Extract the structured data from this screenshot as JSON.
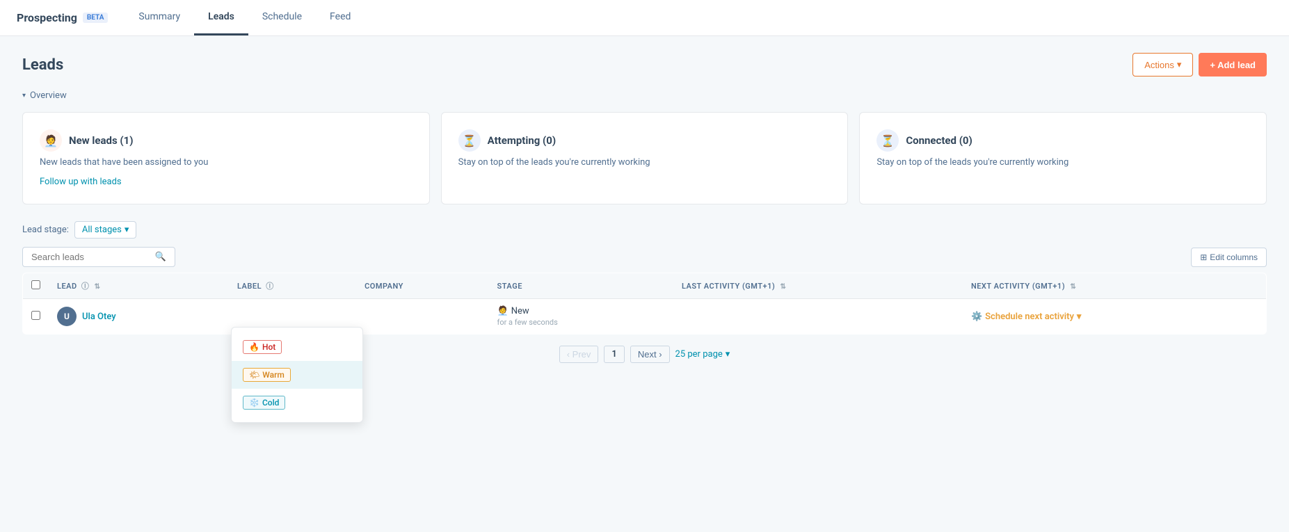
{
  "app": {
    "title": "Prospecting",
    "beta_label": "BETA"
  },
  "nav": {
    "tabs": [
      {
        "id": "summary",
        "label": "Summary",
        "active": false
      },
      {
        "id": "leads",
        "label": "Leads",
        "active": true
      },
      {
        "id": "schedule",
        "label": "Schedule",
        "active": false
      },
      {
        "id": "feed",
        "label": "Feed",
        "active": false
      }
    ]
  },
  "page": {
    "title": "Leads",
    "actions_label": "Actions",
    "add_lead_label": "+ Add lead"
  },
  "overview": {
    "section_label": "Overview",
    "cards": [
      {
        "id": "new-leads",
        "icon": "🧑‍💼",
        "title": "New leads (1)",
        "description": "New leads that have been assigned to you",
        "link_text": "Follow up with leads",
        "icon_bg": "new"
      },
      {
        "id": "attempting",
        "icon": "⏳",
        "title": "Attempting (0)",
        "description": "Stay on top of the leads you're currently working",
        "link_text": "",
        "icon_bg": "attempting"
      },
      {
        "id": "connected",
        "icon": "⏳",
        "title": "Connected (0)",
        "description": "Stay on top of the leads you're currently working",
        "link_text": "",
        "icon_bg": "connected"
      }
    ]
  },
  "stage_filter": {
    "label": "Lead stage:",
    "selected": "All stages"
  },
  "search": {
    "placeholder": "Search leads"
  },
  "edit_columns_label": "Edit columns",
  "table": {
    "columns": [
      {
        "id": "lead",
        "label": "LEAD",
        "info": true,
        "sortable": true
      },
      {
        "id": "label",
        "label": "LABEL",
        "info": true,
        "sortable": false
      },
      {
        "id": "company",
        "label": "COMPANY",
        "info": false,
        "sortable": false
      },
      {
        "id": "stage",
        "label": "STAGE",
        "info": false,
        "sortable": false
      },
      {
        "id": "last_activity",
        "label": "LAST ACTIVITY (GMT+1)",
        "info": false,
        "sortable": true
      },
      {
        "id": "next_activity",
        "label": "NEXT ACTIVITY (GMT+1)",
        "info": false,
        "sortable": true
      }
    ],
    "rows": [
      {
        "id": "1",
        "avatar_initials": "U",
        "name": "Ula Otey",
        "label": "",
        "company": "",
        "stage_name": "New",
        "stage_time": "for a few seconds",
        "last_activity": "",
        "next_activity": "Schedule next activity"
      }
    ]
  },
  "pagination": {
    "prev_label": "Prev",
    "page_num": "1",
    "next_label": "Next",
    "per_page_label": "25 per page"
  },
  "label_dropdown": {
    "items": [
      {
        "id": "hot",
        "emoji": "🔥",
        "label": "Hot",
        "style": "hot"
      },
      {
        "id": "warm",
        "emoji": "🌤",
        "label": "Warm",
        "style": "warm",
        "selected": true
      },
      {
        "id": "cold",
        "emoji": "❄️",
        "label": "Cold",
        "style": "cold"
      }
    ]
  }
}
